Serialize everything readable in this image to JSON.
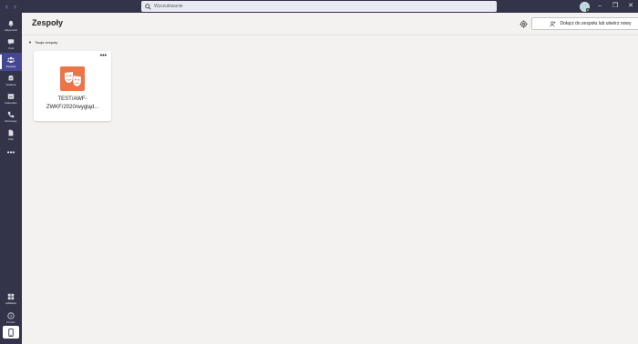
{
  "titlebar": {
    "search_placeholder": "Wyszukiwanie",
    "back_icon": "chevron-left-icon",
    "forward_icon": "chevron-right-icon",
    "minimize": "–",
    "restore": "❐",
    "close": "✕"
  },
  "rail": {
    "items": [
      {
        "label": "Aktywność",
        "icon": "bell-icon"
      },
      {
        "label": "Czat",
        "icon": "chat-icon"
      },
      {
        "label": "Zespoły",
        "icon": "teams-icon"
      },
      {
        "label": "Zadania",
        "icon": "assignments-icon"
      },
      {
        "label": "Kalendarz",
        "icon": "calendar-icon"
      },
      {
        "label": "Rozmowy",
        "icon": "phone-icon"
      },
      {
        "label": "Pliki",
        "icon": "file-icon"
      }
    ],
    "more": "•••",
    "bottom": [
      {
        "label": "Aplikacje",
        "icon": "apps-icon"
      },
      {
        "label": "Pomoc",
        "icon": "help-icon"
      }
    ]
  },
  "header": {
    "title": "Zespoły",
    "join_label": "Dołącz do zespołu lub utwórz nowy"
  },
  "section": {
    "label": "Twoje zespoły"
  },
  "card": {
    "more": "•••",
    "name": "TEST/AWF-ZWKF/2020/wygląd..."
  },
  "colors": {
    "rail_bg": "#33344a",
    "active": "#444791",
    "page_bg": "#f3f2f1",
    "team_tile": "#e97548"
  }
}
